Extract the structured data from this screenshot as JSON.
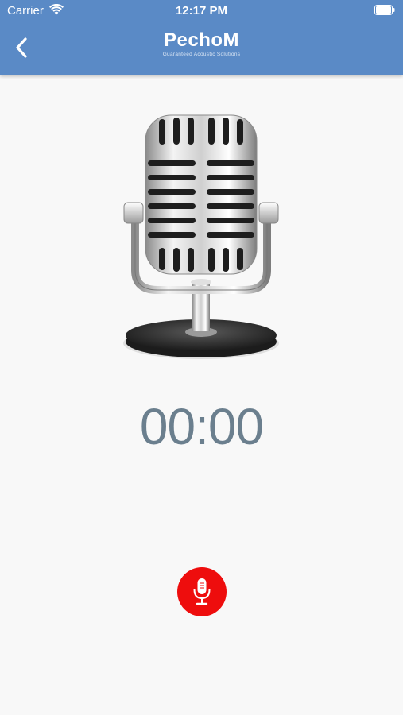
{
  "status_bar": {
    "carrier": "Carrier",
    "time": "12:17 PM"
  },
  "header": {
    "logo_text": "PechoM",
    "logo_tagline": "Guaranteed Acoustic Solutions",
    "back_icon": "chevron-left-icon",
    "background_color": "#5a8ac6"
  },
  "recorder": {
    "timer": "00:00",
    "record_icon": "microphone-icon",
    "record_button_color": "#ee0d0d"
  }
}
